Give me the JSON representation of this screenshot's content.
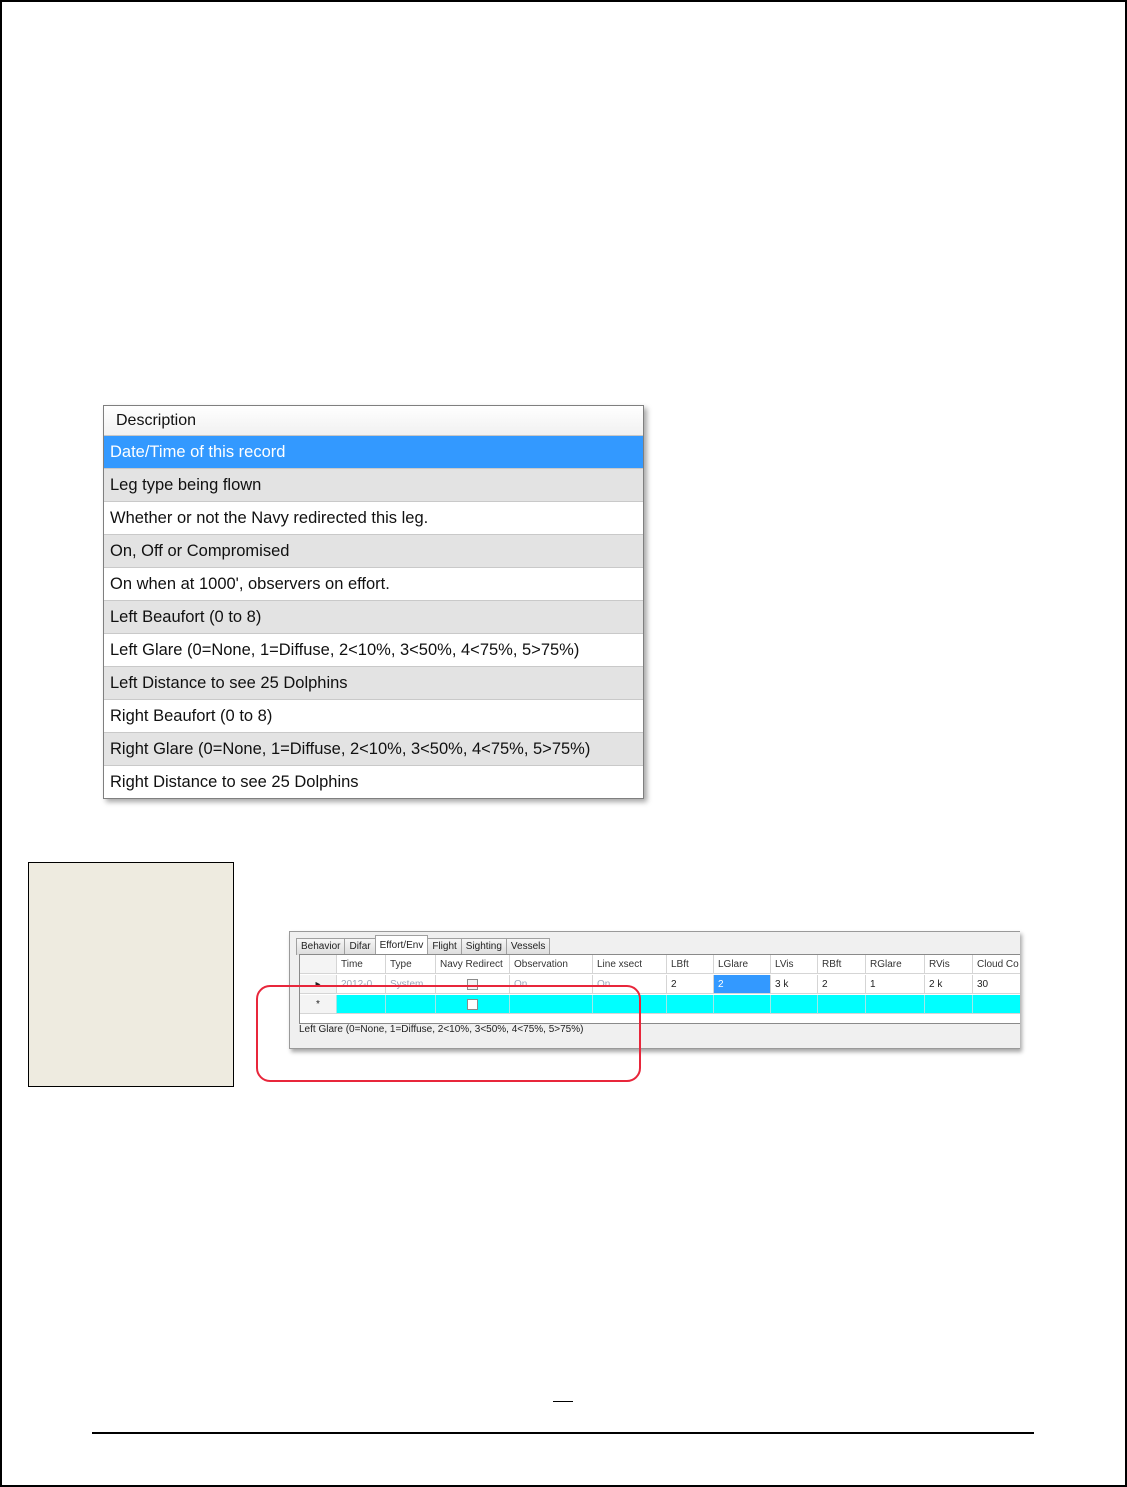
{
  "description_list": {
    "header": "Description",
    "rows": [
      "Date/Time of this record",
      "Leg type being flown",
      "Whether or not the Navy redirected this leg.",
      "On, Off or Compromised",
      "On when at 1000', observers on effort.",
      "Left Beaufort (0 to 8)",
      "Left Glare (0=None, 1=Diffuse, 2<10%, 3<50%, 4<75%, 5>75%)",
      "Left Distance to see 25 Dolphins",
      "Right Beaufort (0 to 8)",
      "Right Glare (0=None, 1=Diffuse, 2<10%, 3<50%, 4<75%, 5>75%)",
      "Right Distance to see 25 Dolphins"
    ],
    "selected_index": 0
  },
  "grid": {
    "tabs": [
      "Behavior",
      "Difar",
      "Effort/Env",
      "Flight",
      "Sighting",
      "Vessels"
    ],
    "active_tab": "Effort/Env",
    "columns": [
      "Time",
      "Type",
      "Navy Redirect",
      "Observation",
      "Line xsect",
      "LBft",
      "LGlare",
      "LVis",
      "RBft",
      "RGlare",
      "RVis",
      "Cloud Co"
    ],
    "row": {
      "indicator": "▸",
      "time": "2012-0...",
      "type": "System...",
      "observation": "On",
      "line_xsect": "On",
      "lbft": "2",
      "lglare": "2",
      "lvis": "3 k",
      "rbft": "2",
      "rglare": "1",
      "rvis": "2 k",
      "cloud": "30"
    },
    "new_row_indicator": "*",
    "status": "Left Glare (0=None, 1=Diffuse, 2<10%, 3<50%, 4<75%, 5>75%)"
  },
  "colors": {
    "selection": "#3399ff",
    "new_row": "#00ffff",
    "highlight_outline": "#e8263b",
    "beige": "#eeebe0"
  }
}
